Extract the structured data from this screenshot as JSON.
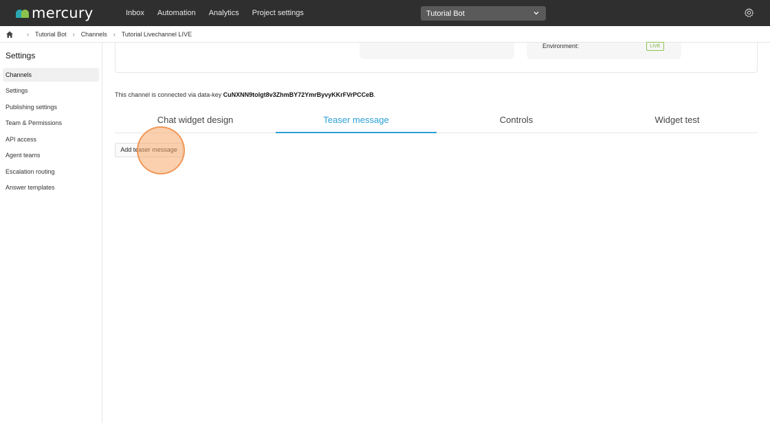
{
  "app": {
    "logo_text": "mercury"
  },
  "topnav": {
    "items": [
      "Inbox",
      "Automation",
      "Analytics",
      "Project settings"
    ],
    "bot_select": "Tutorial Bot"
  },
  "breadcrumb": {
    "items": [
      "Tutorial Bot",
      "Channels",
      "Tutorial Livechannel LIVE"
    ]
  },
  "sidebar": {
    "title": "Settings",
    "items": [
      "Channels",
      "Settings",
      "Publishing settings",
      "Team & Permissions",
      "API access",
      "Agent teams",
      "Escalation routing",
      "Answer templates"
    ],
    "active": "Channels"
  },
  "channel": {
    "environment_label": "Environment:",
    "environment_badge": "LIVE",
    "datakey_prefix": "This channel is connected via data-key ",
    "datakey": "CuNXNN9tolgt8v3ZhmBY72YmrByvyKKrFVrPCCeB",
    "datakey_suffix": "."
  },
  "tabs": {
    "items": [
      "Chat widget design",
      "Teaser message",
      "Controls",
      "Widget test"
    ],
    "active": "Teaser message"
  },
  "actions": {
    "add_teaser": "Add teaser message"
  },
  "colors": {
    "accent": "#2a9fd6",
    "live_green": "#8bc34a",
    "topbar": "#2f2f2f"
  },
  "icons": [
    "home-icon",
    "chevron-right-icon",
    "chevron-down-icon",
    "gear-icon"
  ]
}
